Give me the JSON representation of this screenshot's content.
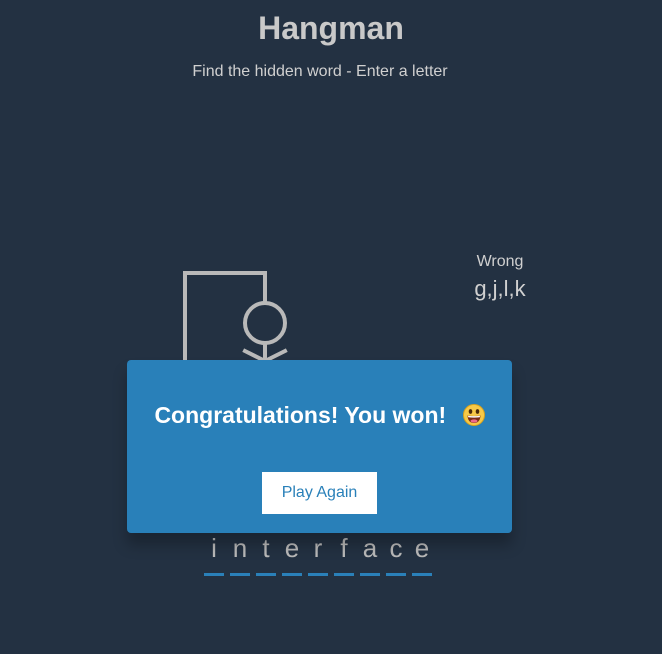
{
  "header": {
    "title": "Hangman",
    "subtitle": "Find the hidden word - Enter a letter"
  },
  "wrong": {
    "label": "Wrong",
    "letters": "g,j,l,k"
  },
  "word": {
    "letters": [
      "i",
      "n",
      "t",
      "e",
      "r",
      "f",
      "a",
      "c",
      "e"
    ]
  },
  "popup": {
    "message": "Congratulations! You won!",
    "emoji_icon": "grinning-face-icon",
    "play_again_label": "Play Again"
  },
  "colors": {
    "background": "#233142",
    "popup": "#2980b9",
    "underline": "#2a80b9",
    "figure": "#b9b9b9"
  }
}
